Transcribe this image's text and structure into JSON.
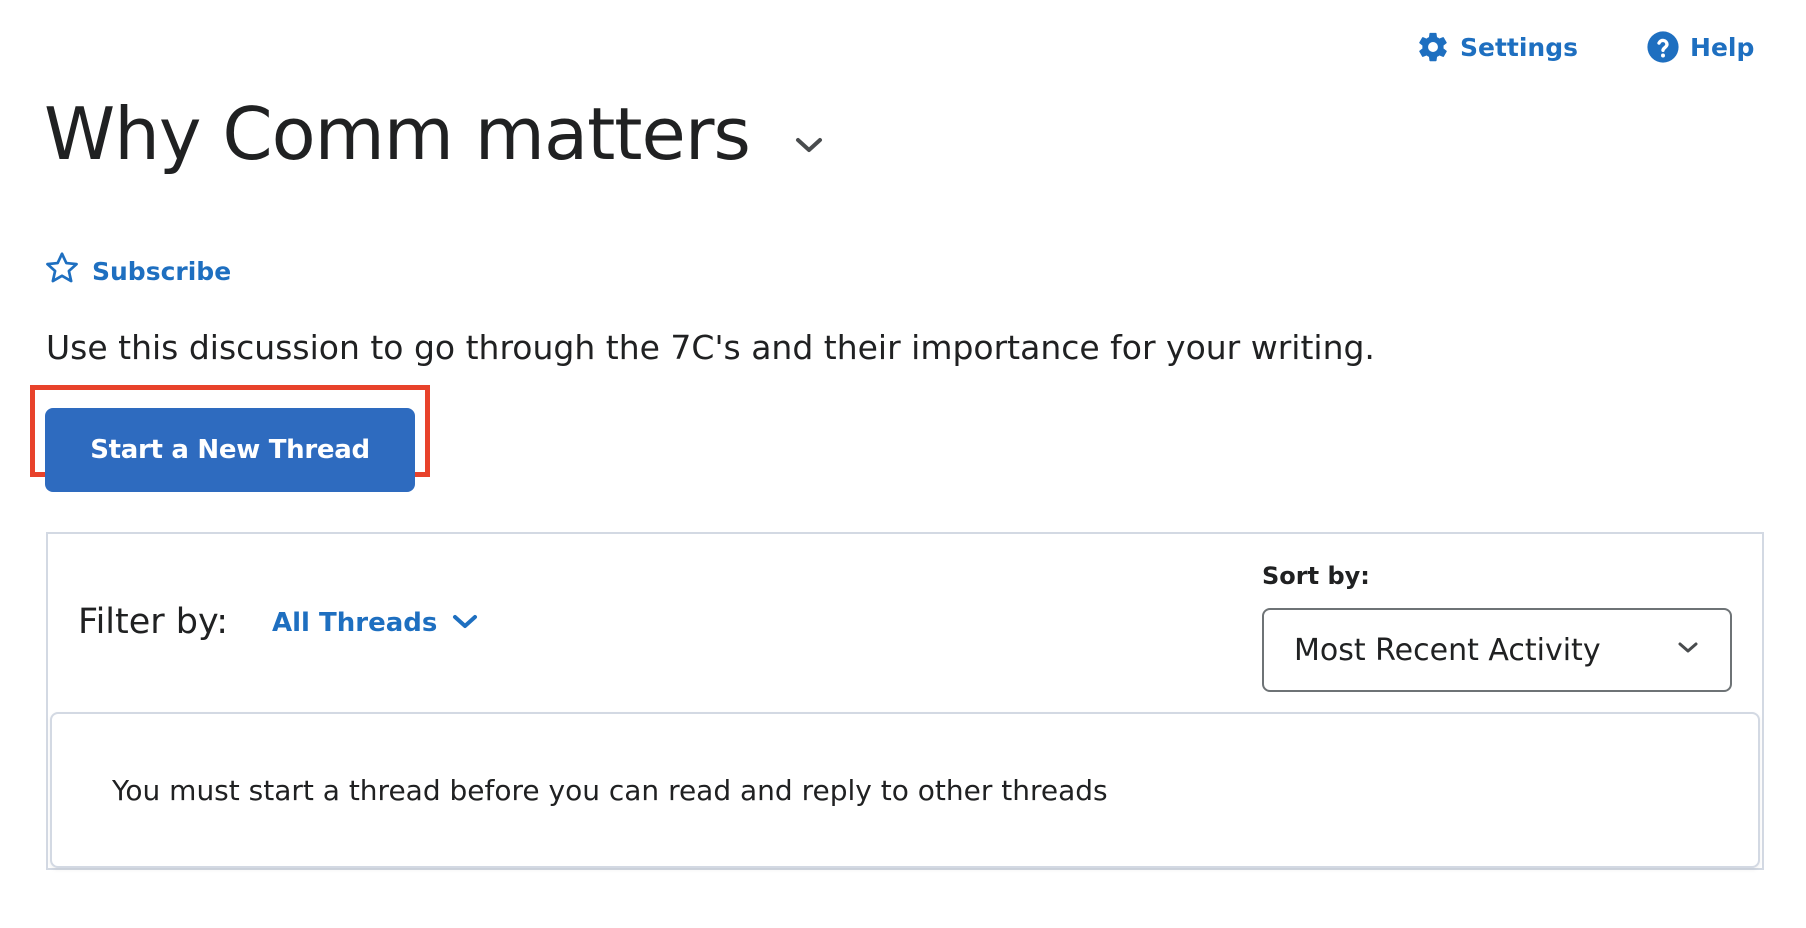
{
  "header": {
    "settings_label": "Settings",
    "help_label": "Help",
    "settings_icon": "gear-icon",
    "help_icon": "question-circle-icon"
  },
  "topic": {
    "title": "Why Comm matters",
    "title_menu_icon": "chevron-down-icon",
    "subscribe_label": "Subscribe",
    "subscribe_icon": "star-outline-icon",
    "description": "Use this discussion to go through the 7C's and their importance for your writing."
  },
  "actions": {
    "start_thread_label": "Start a New Thread"
  },
  "threads_panel": {
    "filter_label": "Filter by:",
    "filter_value": "All Threads",
    "sort_label": "Sort by:",
    "sort_value": "Most Recent Activity",
    "notice": "You must start a thread before you can read and reply to other threads"
  },
  "colors": {
    "link_blue": "#1e6fc0",
    "primary_button": "#2e6bbf",
    "highlight_red": "#e8422b",
    "text_dark": "#202122",
    "border_light": "#d3d9e3"
  }
}
